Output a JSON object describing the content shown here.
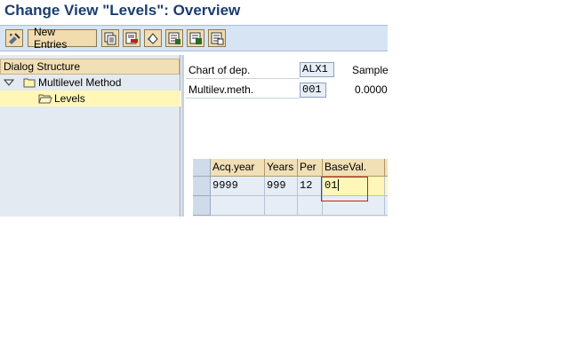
{
  "window": {
    "title": "Change View \"Levels\": Overview"
  },
  "toolbar": {
    "new_entries_label": "New Entries",
    "icons": [
      "display-change-icon",
      "copy-icon",
      "delete-icon",
      "undo-icon",
      "select-all-icon",
      "select-block-icon",
      "deselect-all-icon"
    ]
  },
  "dialog": {
    "header": "Dialog Structure",
    "items": [
      {
        "label": "Multilevel Method",
        "expanded": true
      },
      {
        "label": "Levels",
        "selected": true
      }
    ]
  },
  "header_fields": {
    "chart_label": "Chart of dep.",
    "chart_value": "ALX1",
    "chart_desc": "Sample",
    "method_label": "Multilev.meth.",
    "method_value": "001",
    "method_desc": "0.0000"
  },
  "table": {
    "columns": [
      "Acq.year",
      "Years",
      "Per",
      "BaseVal."
    ],
    "rows": [
      {
        "acq_year": "9999",
        "years": "999",
        "per": "12",
        "base_val": "01"
      },
      {
        "acq_year": "",
        "years": "",
        "per": "",
        "base_val": ""
      }
    ]
  },
  "colors": {
    "title": "#1a3e6e",
    "toolbar_bg": "#d6e4f4",
    "header_bg": "#f1dfb5",
    "highlight": "#d01919"
  }
}
